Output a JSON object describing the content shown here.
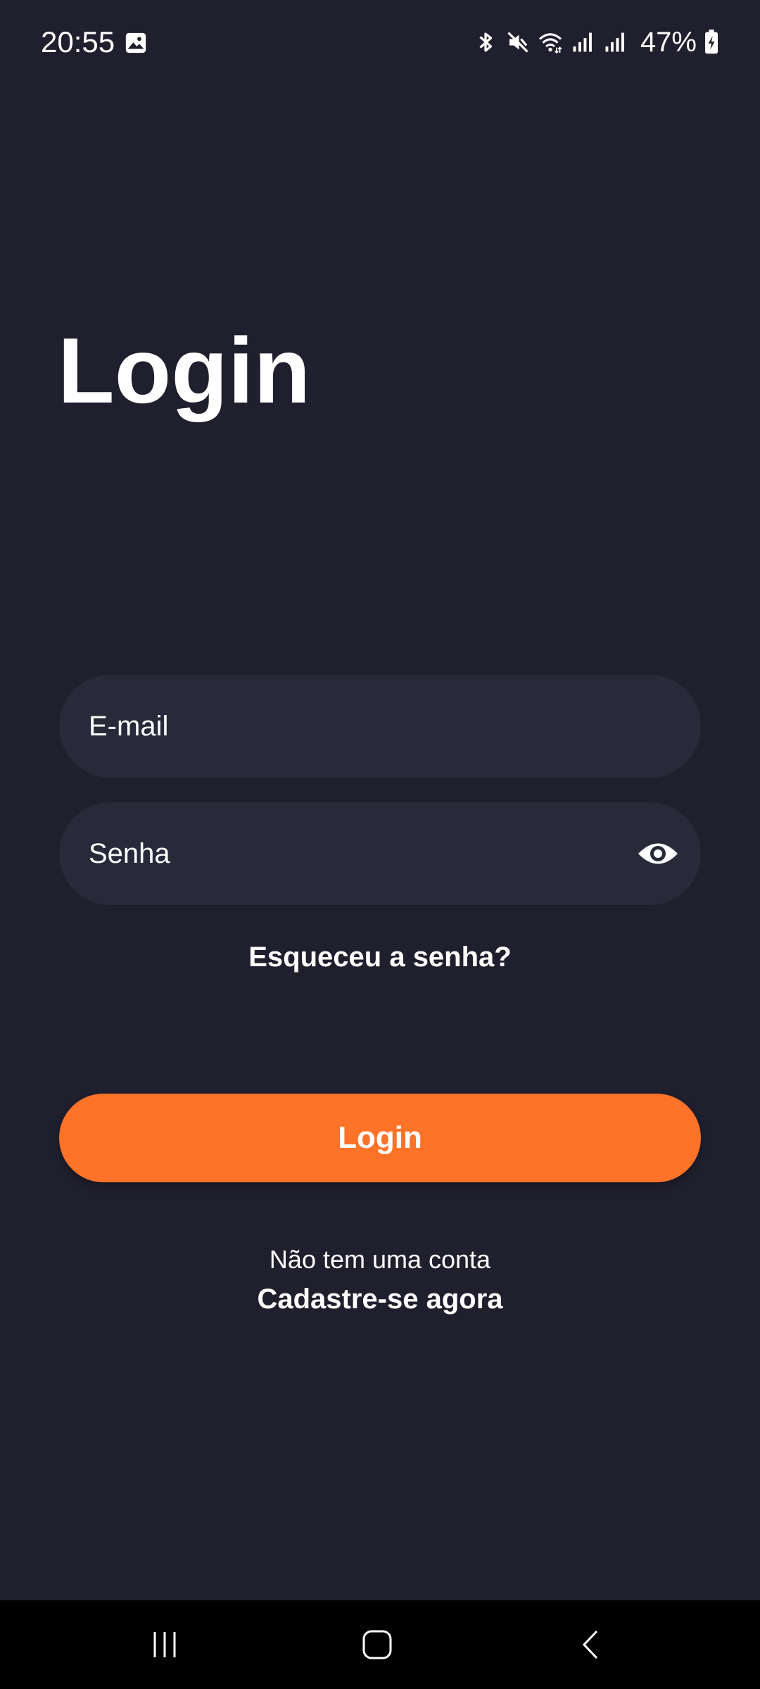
{
  "status_bar": {
    "time": "20:55",
    "battery": "47%",
    "icons": [
      "gallery-icon",
      "bluetooth-icon",
      "mute-icon",
      "wifi-icon",
      "signal-icon",
      "signal-icon",
      "battery-charging-icon"
    ]
  },
  "page": {
    "title": "Login"
  },
  "form": {
    "email_placeholder": "E-mail",
    "email_value": "",
    "password_placeholder": "Senha",
    "password_value": "",
    "forgot_password": "Esqueceu a senha?",
    "login_button": "Login",
    "no_account_text": "Não tem uma conta",
    "signup_link": "Cadastre-se agora"
  },
  "colors": {
    "background": "#201f2d",
    "input_background": "#282a3a",
    "accent": "#ff7328",
    "text": "#ffffff"
  },
  "nav_bar": {
    "icons": [
      "recent-apps-icon",
      "home-icon",
      "back-icon"
    ]
  }
}
